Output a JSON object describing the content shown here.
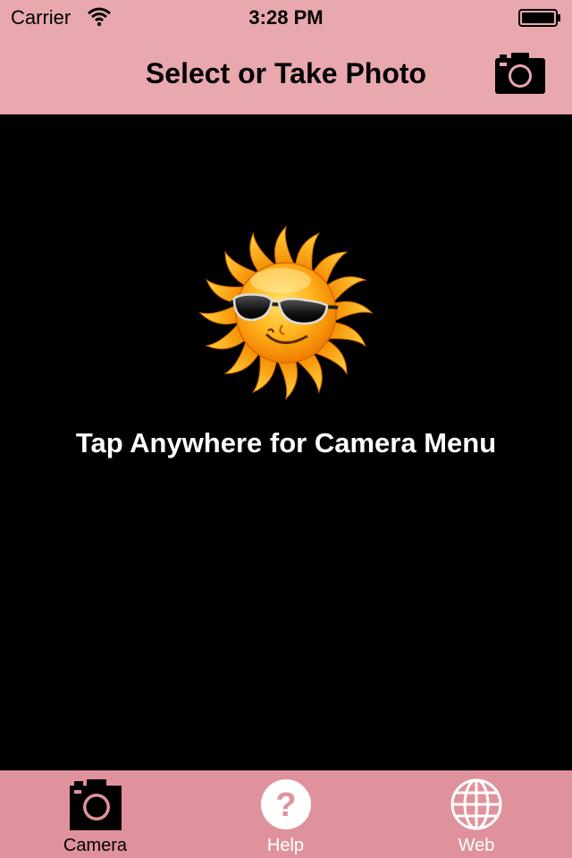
{
  "status_bar": {
    "carrier": "Carrier",
    "time": "3:28 PM"
  },
  "nav_bar": {
    "title": "Select or Take Photo",
    "right_button_icon": "camera-icon"
  },
  "main": {
    "image_icon": "cool-sun-icon",
    "message": "Tap Anywhere for Camera Menu"
  },
  "tab_bar": {
    "tabs": [
      {
        "label": "Camera",
        "icon": "camera-icon",
        "selected": true
      },
      {
        "label": "Help",
        "icon": "question-icon",
        "selected": false
      },
      {
        "label": "Web",
        "icon": "globe-icon",
        "selected": false
      }
    ]
  },
  "colors": {
    "bar_background": "#e8a8ae",
    "tab_bar_background": "#e0929c",
    "content_background": "#000000"
  }
}
